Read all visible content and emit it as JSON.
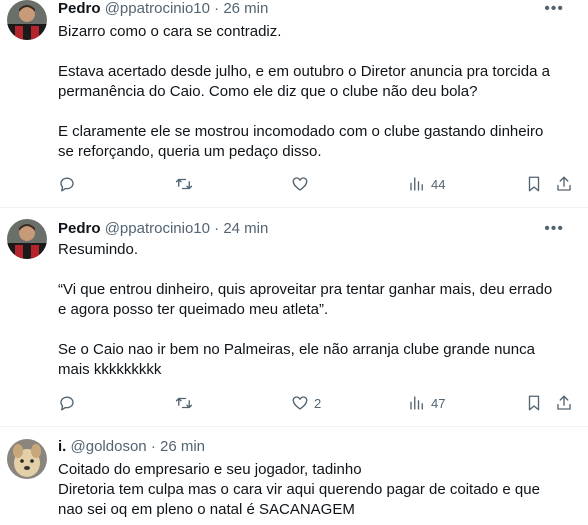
{
  "tweets": [
    {
      "name": "Pedro",
      "handle": "@ppatrocinio10",
      "dot": "·",
      "time": "26 min",
      "paragraphs": [
        [
          "Bizarro como o cara se contradiz."
        ],
        [
          "Estava acertado desde julho, e em outubro o Diretor anuncia pra torcida a",
          "permanência do Caio. Como ele diz que o clube não deu bola?"
        ],
        [
          "E claramente ele se mostrou incomodado com o clube gastando dinheiro",
          "se reforçando, queria um pedaço disso."
        ]
      ],
      "likes": "",
      "views": "44"
    },
    {
      "name": "Pedro",
      "handle": "@ppatrocinio10",
      "dot": "·",
      "time": "24 min",
      "paragraphs": [
        [
          "Resumindo."
        ],
        [
          "“Vi que entrou dinheiro, quis aproveitar pra tentar ganhar mais, deu errado",
          "e agora posso ter queimado meu atleta”."
        ],
        [
          "Se o Caio nao ir bem no Palmeiras, ele não arranja clube grande nunca",
          "mais kkkkkkkkk"
        ]
      ],
      "likes": "2",
      "views": "47"
    },
    {
      "name": "i.",
      "handle": "@goldoson",
      "dot": "·",
      "time": "26 min",
      "paragraphs": [
        [
          "Coitado do empresario e seu jogador, tadinho",
          "Diretoria tem culpa mas o cara vir aqui querendo pagar de coitado e que",
          "nao sei oq em pleno o natal é SACANAGEM"
        ]
      ]
    }
  ],
  "icons": [
    "reply-icon",
    "retweet-icon",
    "like-icon",
    "views-icon",
    "bookmark-icon",
    "share-icon",
    "more-icon"
  ]
}
